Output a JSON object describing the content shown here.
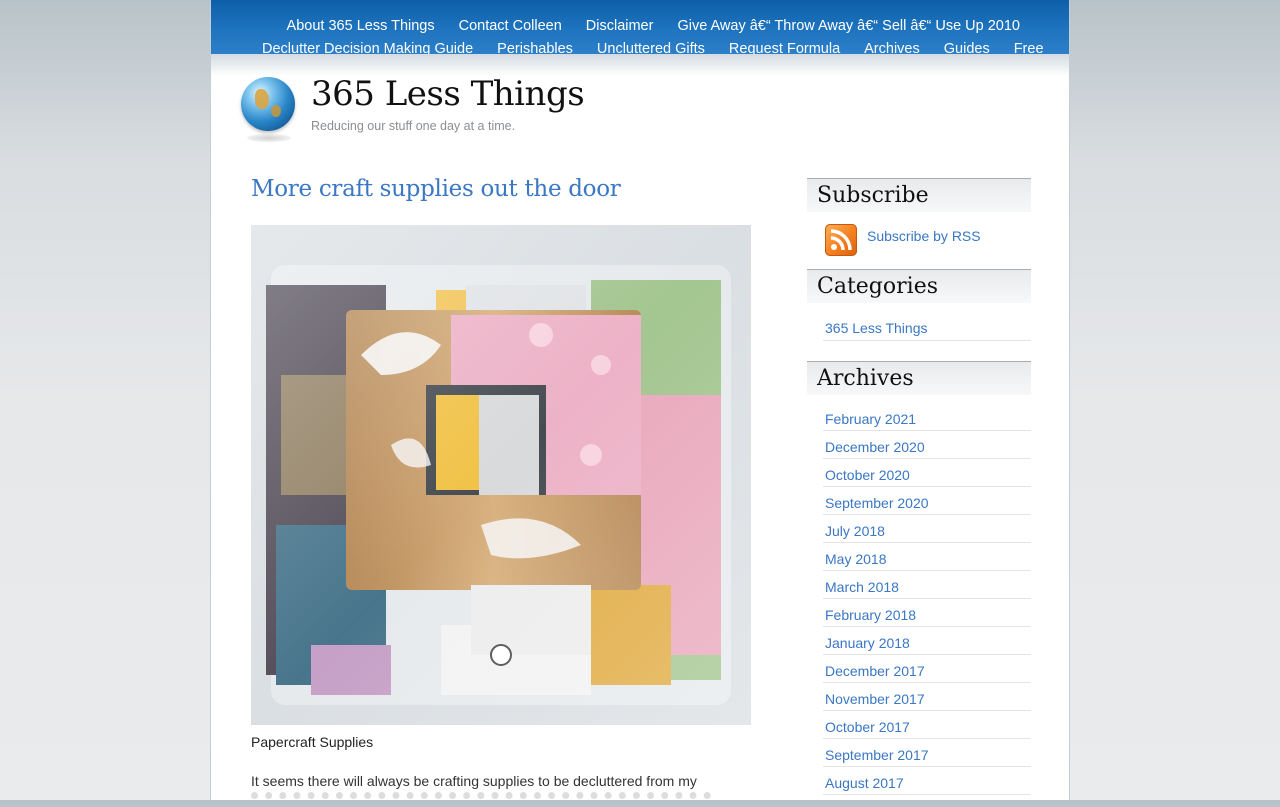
{
  "nav": {
    "row1": [
      "About 365 Less Things",
      "Contact Colleen",
      "Disclaimer",
      "Give Away â€“ Throw Away â€“ Sell â€“ Use Up 2010"
    ],
    "row2": [
      "Declutter Decision Making Guide",
      "Perishables",
      "Uncluttered Gifts",
      "Request Formula",
      "Archives",
      "Guides",
      "Free"
    ]
  },
  "header": {
    "title": "365 Less Things",
    "tagline": "Reducing our stuff one day at a time.",
    "logo_icon": "globe-icon"
  },
  "post": {
    "title": "More craft supplies out the door",
    "caption": "Papercraft Supplies",
    "excerpt": "It seems there will always be crafting supplies to be decluttered from my"
  },
  "sidebar": {
    "subscribe_title": "Subscribe",
    "rss_label": "Subscribe by RSS",
    "rss_icon": "rss-icon",
    "categories_title": "Categories",
    "categories": [
      "365 Less Things"
    ],
    "archives_title": "Archives",
    "archives": [
      "February 2021",
      "December 2020",
      "October 2020",
      "September 2020",
      "July 2018",
      "May 2018",
      "March 2018",
      "February 2018",
      "January 2018",
      "December 2017",
      "November 2017",
      "October 2017",
      "September 2017",
      "August 2017"
    ]
  },
  "colors": {
    "nav_blue": "#1f74bf",
    "link_blue": "#3a77c4",
    "rss_orange": "#f57f1f"
  }
}
